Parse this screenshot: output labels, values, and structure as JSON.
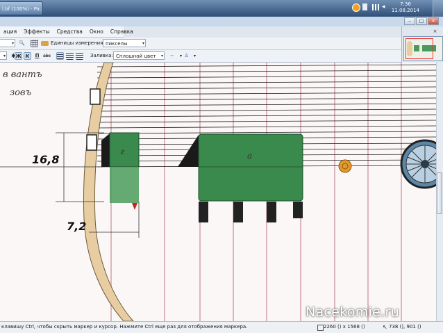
{
  "taskbar": {
    "window_button_label": "l.bf (100%) - Pa…",
    "clock_time": "7:36",
    "clock_date": "11.08.2014"
  },
  "menu": [
    "ация",
    "Эффекты",
    "Средства",
    "Окно",
    "Справка"
  ],
  "toolbar1": {
    "units_label": "Единицы измерения:",
    "units_value": "пикселы"
  },
  "toolbar2": {
    "bold": "Ж",
    "italic": "К",
    "underline": "П",
    "strike": "abc",
    "fill_label": "Заливка:",
    "fill_value": "Сплошной цвет"
  },
  "drawing": {
    "dimension_height": "16,8",
    "dimension_width": "7,2",
    "script_top": "в вантъ",
    "script_second": "зовъ",
    "letter_small_car": "г",
    "letter_large_car": "а"
  },
  "statusbar": {
    "hint": "клавишу Ctrl, чтобы скрыть маркер и курсор. Нажмите Ctrl еще раз для отображения маркера.",
    "image_size": "2260 () x 1568 ()",
    "cursor_position": "738 (), 901 ()"
  },
  "watermark": "Nacekomie.ru",
  "colors": {
    "car_green": "#3a8a4e",
    "plank": "#e8cda2",
    "gridline": "#1a1a1a",
    "vline": "#c98a96"
  }
}
